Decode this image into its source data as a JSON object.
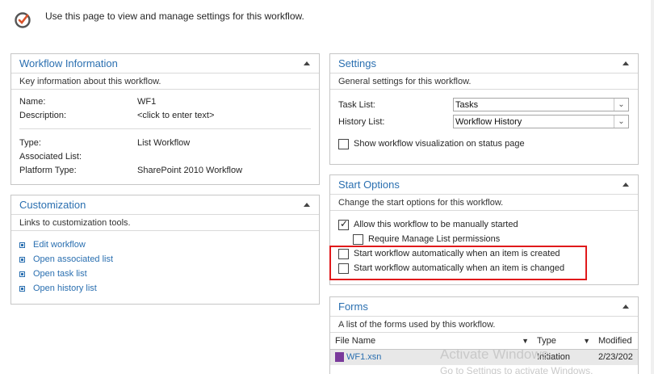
{
  "header": {
    "text": "Use this page to view and manage settings for this workflow."
  },
  "workflow_info": {
    "title": "Workflow Information",
    "desc": "Key information about this workflow.",
    "name_label": "Name:",
    "name_value": "WF1",
    "description_label": "Description:",
    "description_value": "<click to enter text>",
    "type_label": "Type:",
    "type_value": "List Workflow",
    "assoc_label": "Associated List:",
    "assoc_value": "",
    "platform_label": "Platform Type:",
    "platform_value": "SharePoint 2010 Workflow"
  },
  "customization": {
    "title": "Customization",
    "desc": "Links to customization tools.",
    "links": [
      "Edit workflow",
      "Open associated list",
      "Open task list",
      "Open history list"
    ]
  },
  "settings": {
    "title": "Settings",
    "desc": "General settings for this workflow.",
    "task_list_label": "Task List:",
    "task_list_value": "Tasks",
    "history_list_label": "History List:",
    "history_list_value": "Workflow History",
    "visualization_label": "Show workflow visualization on status page"
  },
  "start_options": {
    "title": "Start Options",
    "desc": "Change the start options for this workflow.",
    "manual_label": "Allow this workflow to be manually started",
    "manage_perm_label": "Require Manage List permissions",
    "on_create_label": "Start workflow automatically when an item is created",
    "on_change_label": "Start workflow automatically when an item is changed"
  },
  "forms": {
    "title": "Forms",
    "desc": "A list of the forms used by this workflow.",
    "columns": [
      "File Name",
      "Type",
      "Modified"
    ],
    "rows": [
      {
        "file": "WF1.xsn",
        "type": "Initiation",
        "modified": "2/23/202"
      }
    ]
  },
  "watermark": {
    "line1": "Activate Windows",
    "line2": "Go to Settings to activate Windows."
  },
  "colors": {
    "accent": "#2a6fb0",
    "highlight": "#e0191b"
  }
}
